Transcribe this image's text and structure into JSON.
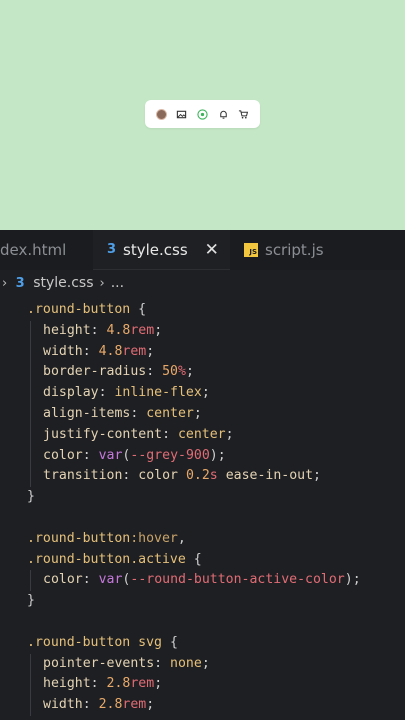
{
  "tabs": [
    {
      "label": "dex.html",
      "active": false
    },
    {
      "label": "style.css",
      "active": true,
      "icon": "css3-icon",
      "close": "✕"
    },
    {
      "label": "script.js",
      "active": false,
      "icon": "js-icon"
    }
  ],
  "breadcrumb": {
    "file": "style.css",
    "more": "..."
  },
  "code": {
    "l1": {
      "sel": ".round-button",
      "brace": "{"
    },
    "l2": {
      "prop": "height",
      "num": "4.8",
      "unit": "rem"
    },
    "l3": {
      "prop": "width",
      "num": "4.8",
      "unit": "rem"
    },
    "l4": {
      "prop": "border-radius",
      "num": "50",
      "unit": "%"
    },
    "l5": {
      "prop": "display",
      "val": "inline-flex"
    },
    "l6": {
      "prop": "align-items",
      "val": "center"
    },
    "l7": {
      "prop": "justify-content",
      "val": "center"
    },
    "l8": {
      "prop": "color",
      "fn": "var",
      "var": "--grey-900"
    },
    "l9": {
      "prop": "transition",
      "a": "color",
      "num": "0.2",
      "unit": "s",
      "b": "ease-in-out"
    },
    "l10": "}",
    "l12": {
      "sel": ".round-button",
      "pseudo": ":hover",
      "comma": ","
    },
    "l13": {
      "sel": ".round-button.active",
      "brace": "{"
    },
    "l14": {
      "prop": "color",
      "fn": "var",
      "var": "--round-button-active-color"
    },
    "l15": "}",
    "l17": {
      "sel": ".round-button svg",
      "brace": "{"
    },
    "l18": {
      "prop": "pointer-events",
      "val": "none"
    },
    "l19": {
      "prop": "height",
      "num": "2.8",
      "unit": "rem"
    },
    "l20": {
      "prop": "width",
      "num": "2.8",
      "unit": "rem"
    }
  },
  "colors": {
    "preview_bg": "#c4e7c5",
    "editor_bg": "#1e1f22",
    "css_icon": "#4f9fe8",
    "js_icon": "#f2c73f"
  }
}
